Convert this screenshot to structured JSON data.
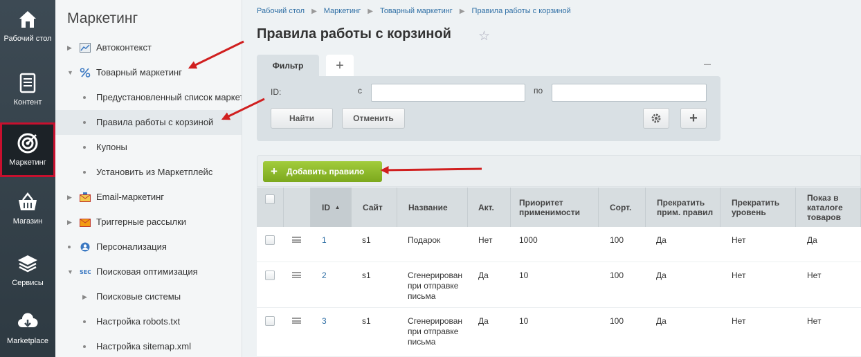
{
  "rail": {
    "items": [
      {
        "label": "Рабочий стол",
        "icon": "home-icon"
      },
      {
        "label": "Контент",
        "icon": "document-icon"
      },
      {
        "label": "Маркетинг",
        "icon": "target-icon",
        "active": true
      },
      {
        "label": "Магазин",
        "icon": "basket-icon"
      },
      {
        "label": "Сервисы",
        "icon": "layers-icon"
      },
      {
        "label": "Marketplace",
        "icon": "cloud-download-icon"
      }
    ]
  },
  "sidebar": {
    "title": "Маркетинг",
    "items": [
      {
        "label": "Автоконтекст",
        "icon": "chart-icon"
      },
      {
        "label": "Товарный маркетинг",
        "icon": "percent-icon"
      },
      {
        "label": "Предустановленный список маркет"
      },
      {
        "label": "Правила работы с корзиной"
      },
      {
        "label": "Купоны"
      },
      {
        "label": "Установить из Маркетплейс"
      },
      {
        "label": "Email-маркетинг",
        "icon": "mail-icon"
      },
      {
        "label": "Триггерные рассылки",
        "icon": "trigger-mail-icon"
      },
      {
        "label": "Персонализация",
        "icon": "person-icon"
      },
      {
        "label": "Поисковая оптимизация",
        "icon": "seo-icon"
      },
      {
        "label": "Поисковые системы"
      },
      {
        "label": "Настройка robots.txt"
      },
      {
        "label": "Настройка sitemap.xml"
      }
    ]
  },
  "breadcrumbs": [
    "Рабочий стол",
    "Маркетинг",
    "Товарный маркетинг",
    "Правила работы с корзиной"
  ],
  "page": {
    "title": "Правила работы с корзиной"
  },
  "filter": {
    "tab_label": "Фильтр",
    "add_tab": "+",
    "collapse": "–",
    "id_label": "ID:",
    "from_label": "с",
    "to_label": "по",
    "from_value": "",
    "to_value": "",
    "find_label": "Найти",
    "cancel_label": "Отменить",
    "add_field": "+"
  },
  "toolbar": {
    "add_label": "Добавить правило",
    "add_plus": "+"
  },
  "table": {
    "sort_indicator": "▲",
    "columns": [
      "ID",
      "Сайт",
      "Название",
      "Акт.",
      "Приоритет применимости",
      "Сорт.",
      "Прекратить прим. правил",
      "Прекратить уровень",
      "Показ в каталоге товаров"
    ],
    "rows": [
      {
        "id": "1",
        "site": "s1",
        "name": "Подарок",
        "active": "Нет",
        "priority": "1000",
        "sort": "100",
        "stop_rules": "Да",
        "stop_level": "Нет",
        "catalog": "Да"
      },
      {
        "id": "2",
        "site": "s1",
        "name": "Сгенерирован при отправке письма",
        "active": "Да",
        "priority": "10",
        "sort": "100",
        "stop_rules": "Да",
        "stop_level": "Нет",
        "catalog": "Нет"
      },
      {
        "id": "3",
        "site": "s1",
        "name": "Сгенерирован при отправке письма",
        "active": "Да",
        "priority": "10",
        "sort": "100",
        "stop_rules": "Да",
        "stop_level": "Нет",
        "catalog": "Нет"
      }
    ]
  },
  "colors": {
    "rail_bg": "#344049",
    "accent_red": "#c8102e",
    "add_green": "#8cb82b",
    "link_blue": "#2f6fa5"
  }
}
